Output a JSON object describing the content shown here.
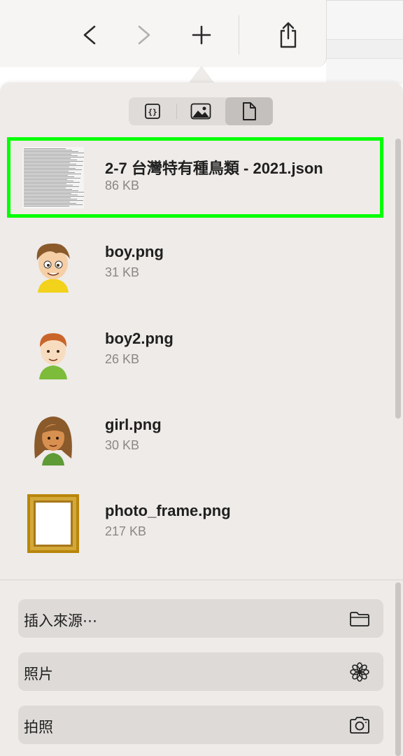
{
  "toolbar": {
    "back_icon": "chevron-left-icon",
    "forward_icon": "chevron-right-icon",
    "new_tab_icon": "plus-icon",
    "share_icon": "share-icon"
  },
  "segmented": [
    {
      "icon": "code-braces-icon",
      "active": false
    },
    {
      "icon": "photo-icon",
      "active": false
    },
    {
      "icon": "document-icon",
      "active": true
    }
  ],
  "files": [
    {
      "name": "2-7 台灣特有種鳥類 - 2021.json",
      "size": "86 KB",
      "thumb": "json-preview",
      "selected": true
    },
    {
      "name": "boy.png",
      "size": "31 KB",
      "thumb": "boy-avatar"
    },
    {
      "name": "boy2.png",
      "size": "26 KB",
      "thumb": "boy2-avatar"
    },
    {
      "name": "girl.png",
      "size": "30 KB",
      "thumb": "girl-avatar"
    },
    {
      "name": "photo_frame.png",
      "size": "217 KB",
      "thumb": "photo-frame"
    }
  ],
  "actions": [
    {
      "label": "插入來源⋯",
      "icon": "folder-icon"
    },
    {
      "label": "照片",
      "icon": "flower-icon"
    },
    {
      "label": "拍照",
      "icon": "camera-icon"
    }
  ],
  "colors": {
    "selection_outline": "#00ff00",
    "popover_bg": "#eeebe8",
    "active_segment": "#c3c0bd"
  }
}
